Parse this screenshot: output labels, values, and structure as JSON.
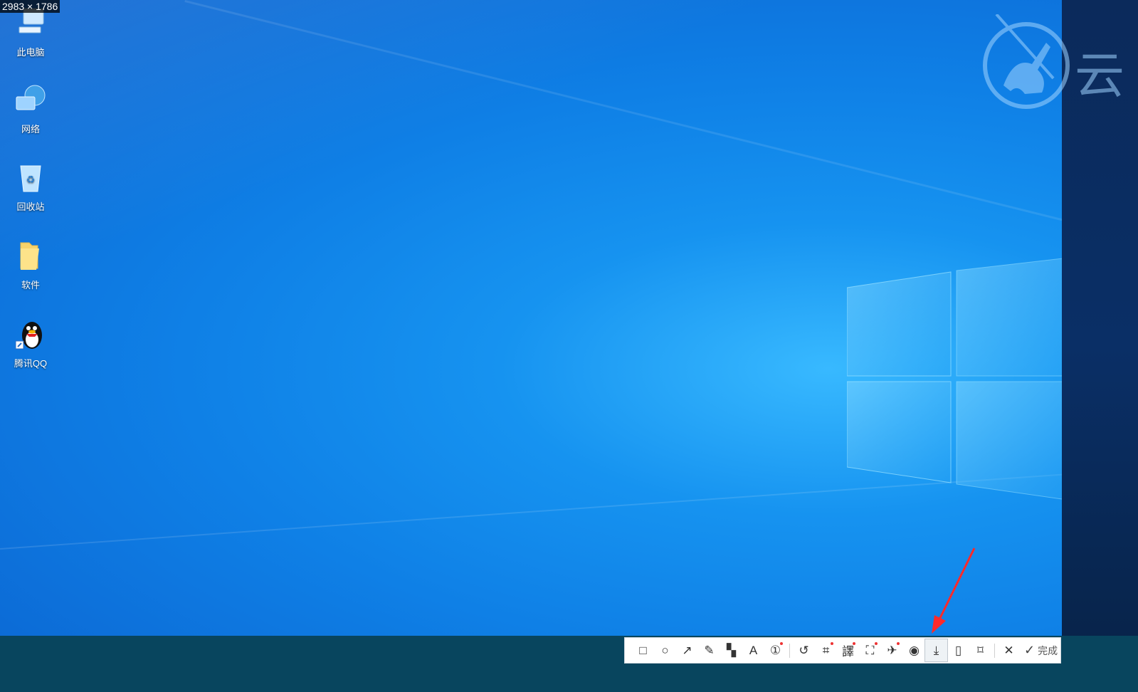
{
  "size_label": "2983 × 1786",
  "desktop_icons": [
    {
      "label": "此电脑",
      "icon": "computer-icon"
    },
    {
      "label": "网络",
      "icon": "network-icon"
    },
    {
      "label": "回收站",
      "icon": "recycle-bin-icon"
    },
    {
      "label": "软件",
      "icon": "folder-icon"
    },
    {
      "label": "腾讯QQ",
      "icon": "qq-penguin-icon"
    }
  ],
  "watermark": {
    "text": "云",
    "icon": "knight-logo-icon"
  },
  "toolbar": {
    "tools": [
      {
        "name": "rectangle-tool",
        "icon": "□"
      },
      {
        "name": "ellipse-tool",
        "icon": "○"
      },
      {
        "name": "arrow-tool",
        "icon": "↗"
      },
      {
        "name": "pen-tool",
        "icon": "✎"
      },
      {
        "name": "mosaic-tool",
        "icon": "▚"
      },
      {
        "name": "text-tool",
        "icon": "A"
      },
      {
        "name": "number-tool",
        "icon": "①"
      },
      {
        "name": "undo-tool",
        "icon": "↺"
      },
      {
        "name": "ocr-tool",
        "icon": "⌗"
      },
      {
        "name": "translate-tool",
        "icon": "譯"
      },
      {
        "name": "scan-tool",
        "icon": "⛶"
      },
      {
        "name": "pin-tool",
        "icon": "✈"
      },
      {
        "name": "record-tool",
        "icon": "◉"
      },
      {
        "name": "long-screenshot-tool",
        "icon": "⤓"
      },
      {
        "name": "save-tool",
        "icon": "▯"
      },
      {
        "name": "bookmark-tool",
        "icon": "⌑"
      },
      {
        "name": "close-tool",
        "icon": "✕"
      }
    ],
    "active_tool": "long-screenshot-tool",
    "done_label": "完成"
  },
  "colors": {
    "annotation_arrow": "#ff2a2a",
    "desktop_blue": "#0f80e6"
  }
}
